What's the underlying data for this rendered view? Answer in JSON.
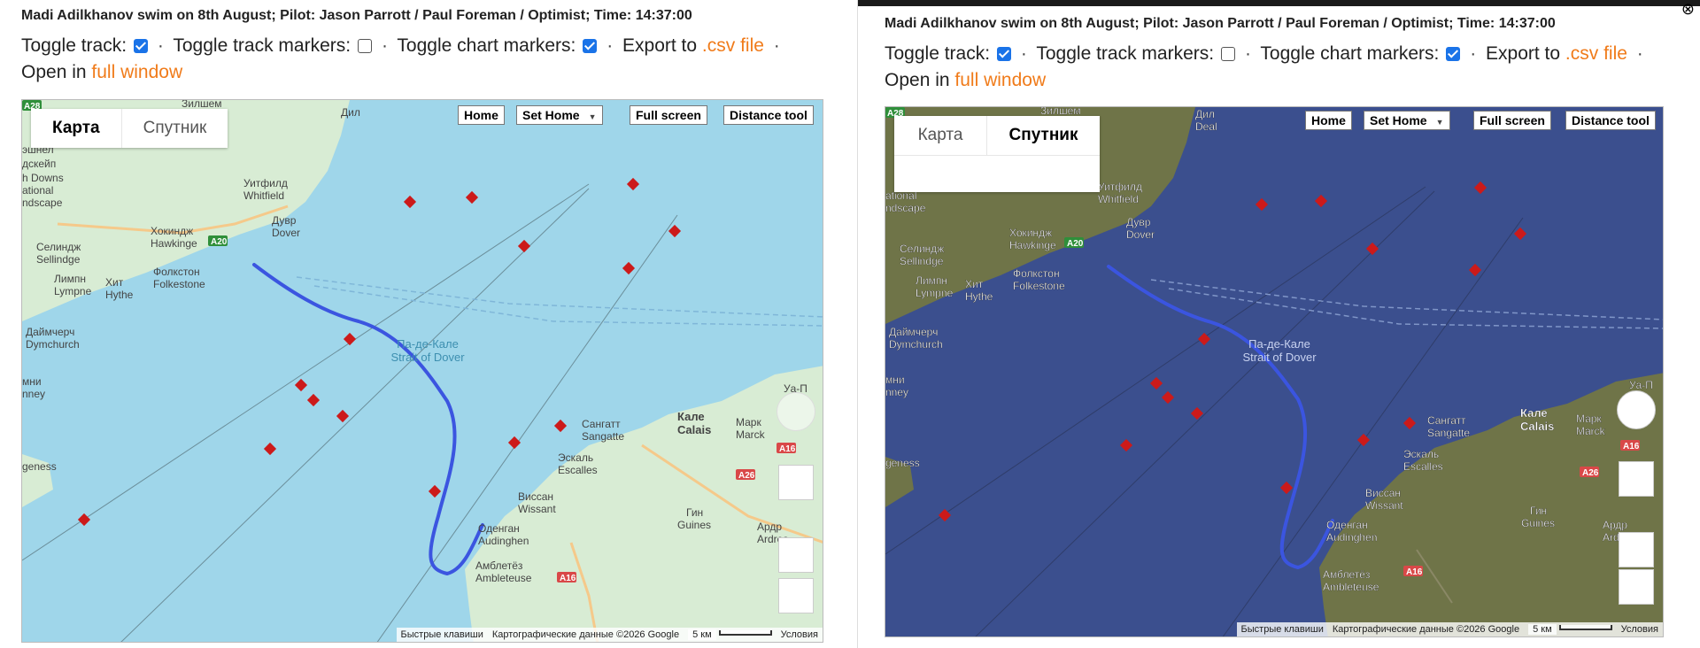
{
  "title": "Madi Adilkhanov swim on 8th August; Pilot: Jason Parrott / Paul Foreman / Optimist; Time: 14:37:00",
  "controls": {
    "toggle_track": "Toggle track:",
    "toggle_track_markers": "Toggle track markers:",
    "toggle_chart_markers": "Toggle chart markers:",
    "export_to": "Export to",
    "csv_link": ".csv file",
    "open_in": "Open in",
    "full_window_link": "full window",
    "separator": "·",
    "track_checked": true,
    "track_markers_checked": false,
    "chart_markers_checked": true
  },
  "map": {
    "type_map_label": "Карта",
    "type_satellite_label": "Спутник",
    "home_button": "Home",
    "set_home_button": "Set Home",
    "full_screen_button": "Full screen",
    "distance_tool_button": "Distance tool",
    "attribution_shortcuts": "Быстрые клавиши",
    "attribution_data": "Картографические данные ©2026 Google",
    "attribution_scale": "5 км",
    "attribution_terms": "Условия",
    "labels": {
      "zilshem": "Зилшем",
      "dil": "Дил",
      "deal": "Deal",
      "whitfield_ru": "Уитфилд",
      "whitfield": "Whitfield",
      "dover_ru": "Дувр",
      "dover": "Dover",
      "hawkinge_ru": "Хокиндж",
      "hawkinge": "Hawkinge",
      "sellindge_ru": "Селиндж",
      "sellindge": "Sellindge",
      "folkestone_ru": "Фолкстон",
      "folkestone": "Folkestone",
      "lympne_ru": "Лимпн",
      "lympne": "Lympne",
      "hythe_ru": "Хит",
      "hythe": "Hythe",
      "dymchurch_ru": "Даймчерч",
      "dymchurch": "Dymchurch",
      "strait_ru": "Па-де-Кале",
      "strait": "Strait of Dover",
      "sangatte_ru": "Сангатт",
      "sangatte": "Sangatte",
      "calais_ru": "Кале",
      "calais": "Calais",
      "marck_ru": "Марк",
      "marck": "Marck",
      "escalles_ru": "Эскаль",
      "escalles": "Escalles",
      "wissant_ru": "Виссан",
      "wissant": "Wissant",
      "guines_ru": "Гин",
      "guines": "Guines",
      "audinghen_ru": "Оденган",
      "audinghen": "Audinghen",
      "ambleteuse_ru": "Амблетёз",
      "ambleteuse": "Ambleteuse",
      "ardres_ru": "Ардр",
      "ardres": "Ardres",
      "road_a20": "A20",
      "road_a16": "A16",
      "road_a26": "A26",
      "road_a28": "A28",
      "partial_1": "эшнел",
      "partial_2": "дскейп",
      "partial_3": "h Downs",
      "partial_4": "ational",
      "partial_5": "ndscape",
      "partial_6": "мни",
      "partial_7": "nney",
      "partial_8": "geness",
      "partial_9": "Уа-П"
    }
  },
  "colors": {
    "sea_map": "#9fd6ea",
    "land_map": "#d8ecd4",
    "sea_sat": "#3b4f8e",
    "land_sat": "#6f7448",
    "track": "#3b55e0",
    "marker": "#cc1a1a",
    "accent_link": "#f07b1a",
    "checkbox": "#1a73e8"
  }
}
